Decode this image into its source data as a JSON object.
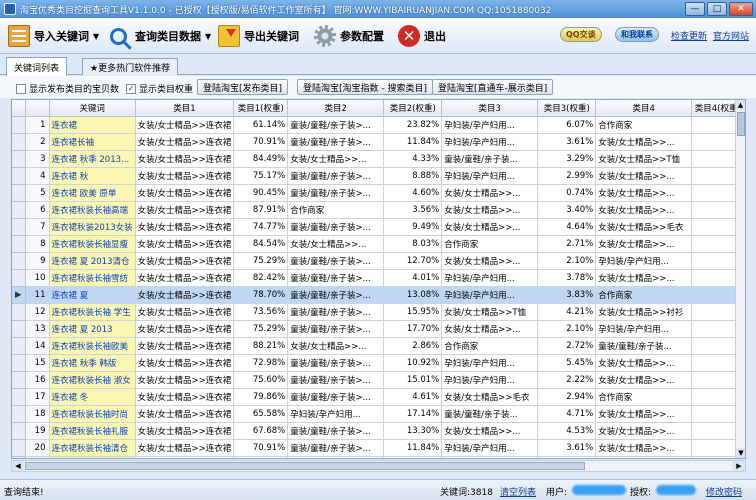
{
  "window": {
    "title": "淘宝优秀类目挖掘查询工具V1.1.0.0 - 已授权【授权版/易佰软件工作室所有】 官网:WWW.YIBAIRUANJIAN.COM QQ:1051880032",
    "min": "—",
    "max": "□",
    "close": "✕"
  },
  "toolbar": {
    "import_label": "导入关键词",
    "search_label": "查询类目数据",
    "export_label": "导出关键词",
    "settings_label": "参数配置",
    "exit_label": "退出",
    "qq_label": "QQ交谈",
    "contact_label": "和我联系",
    "check_update_label": "检查更新",
    "website_label": "官方网站"
  },
  "tabs": [
    {
      "label": "关键词列表"
    },
    {
      "label": "★更多热门软件推荐"
    }
  ],
  "options": {
    "show_shop_count_label": "显示发布类目的宝贝数",
    "show_weight_label": "显示类目权重",
    "show_shop_count_checked": false,
    "show_weight_checked": true,
    "btn1": "登陆淘宝[发布类目]",
    "btn2": "登陆淘宝[淘宝指数 - 搜索类目]",
    "btn3": "登陆淘宝[直通车-展示类目]"
  },
  "grid": {
    "columns": [
      "",
      "",
      "关键词",
      "类目1",
      "类目1(权重)",
      "类目2",
      "类目2(权重)",
      "类目3",
      "类目3(权重)",
      "类目4",
      "类目4(权重)"
    ],
    "selected_index": 10,
    "rows": [
      [
        "1",
        "连衣裙",
        "女装/女士精品>>连衣裙",
        "61.14%",
        "童装/童鞋/亲子装>...",
        "23.82%",
        "孕妇装/孕产妇用...",
        "6.07%",
        "合作商家",
        "4"
      ],
      [
        "2",
        "连衣裙长袖",
        "女装/女士精品>>连衣裙",
        "70.91%",
        "童装/童鞋/亲子装>...",
        "11.84%",
        "孕妇装/孕产妇用...",
        "3.61%",
        "女装/女士精品>>...",
        "3"
      ],
      [
        "3",
        "连衣裙 秋季 2013...",
        "女装/女士精品>>连衣裙",
        "84.49%",
        "女装/女士精品>>...",
        "4.33%",
        "童装/童鞋/亲子装...",
        "3.29%",
        "女装/女士精品>>T恤",
        "1"
      ],
      [
        "4",
        "连衣裙 秋",
        "女装/女士精品>>连衣裙",
        "75.17%",
        "童装/童鞋/亲子装>...",
        "8.88%",
        "孕妇装/孕产妇用...",
        "2.99%",
        "女装/女士精品>>...",
        "2"
      ],
      [
        "5",
        "连衣裙 欧美 原单",
        "女装/女士精品>>连衣裙",
        "90.45%",
        "童装/童鞋/亲子装>...",
        "4.60%",
        "女装/女士精品>>...",
        "0.74%",
        "女装/女士精品>>...",
        "0"
      ],
      [
        "6",
        "连衣裙秋装长袖高端",
        "女装/女士精品>>连衣裙",
        "87.91%",
        "合作商家",
        "3.56%",
        "女装/女士精品>>...",
        "3.40%",
        "女装/女士精品>>...",
        "2"
      ],
      [
        "7",
        "连衣裙秋装2013女装",
        "女装/女士精品>>连衣裙",
        "74.77%",
        "童装/童鞋/亲子装>...",
        "9.49%",
        "女装/女士精品>>...",
        "4.64%",
        "女装/女士精品>>毛衣",
        "3"
      ],
      [
        "8",
        "连衣裙秋装长袖显瘦",
        "女装/女士精品>>连衣裙",
        "84.54%",
        "女装/女士精品>>...",
        "8.03%",
        "合作商家",
        "2.71%",
        "女装/女士精品>>...",
        "0"
      ],
      [
        "9",
        "连衣裙 夏 2013清仓",
        "女装/女士精品>>连衣裙",
        "75.29%",
        "童装/童鞋/亲子装>...",
        "12.70%",
        "女装/女士精品>>...",
        "2.10%",
        "孕妇装/孕产妇用...",
        "2"
      ],
      [
        "10",
        "连衣裙秋装长袖雪纺",
        "女装/女士精品>>连衣裙",
        "82.42%",
        "童装/童鞋/亲子装>...",
        "4.01%",
        "孕妇装/孕产妇用...",
        "3.78%",
        "女装/女士精品>>...",
        "3"
      ],
      [
        "11",
        "连衣裙 夏",
        "女装/女士精品>>连衣裙",
        "78.70%",
        "童装/童鞋/亲子装>...",
        "13.08%",
        "孕妇装/孕产妇用...",
        "3.83%",
        "合作商家",
        "1"
      ],
      [
        "12",
        "连衣裙秋装长袖 学生",
        "女装/女士精品>>连衣裙",
        "73.56%",
        "童装/童鞋/亲子装>...",
        "15.95%",
        "女装/女士精品>>T恤",
        "4.21%",
        "女装/女士精品>>衬衫",
        "1"
      ],
      [
        "13",
        "连衣裙 夏 2013",
        "女装/女士精品>>连衣裙",
        "75.29%",
        "童装/童鞋/亲子装>...",
        "17.70%",
        "女装/女士精品>>...",
        "2.10%",
        "孕妇装/孕产妇用...",
        "2"
      ],
      [
        "14",
        "连衣裙秋装长袖欧美",
        "女装/女士精品>>连衣裙",
        "88.21%",
        "女装/女士精品>>...",
        "2.86%",
        "合作商家",
        "2.72%",
        "童装/童鞋/亲子装...",
        "1"
      ],
      [
        "15",
        "连衣裙 秋季 韩版",
        "女装/女士精品>>连衣裙",
        "72.98%",
        "童装/童鞋/亲子装>...",
        "10.92%",
        "孕妇装/孕产妇用...",
        "5.45%",
        "女装/女士精品>>...",
        "3"
      ],
      [
        "16",
        "连衣裙秋装长袖 淑女",
        "女装/女士精品>>连衣裙",
        "75.60%",
        "童装/童鞋/亲子装>...",
        "15.01%",
        "孕妇装/孕产妇用...",
        "2.22%",
        "女装/女士精品>>...",
        "1"
      ],
      [
        "17",
        "连衣裙 冬",
        "女装/女士精品>>连衣裙",
        "79.86%",
        "童装/童鞋/亲子装>...",
        "4.61%",
        "女装/女士精品>>毛衣",
        "2.94%",
        "合作商家",
        "2"
      ],
      [
        "18",
        "连衣裙秋装长袖时尚",
        "女装/女士精品>>连衣裙",
        "65.58%",
        "孕妇装/孕产妇用...",
        "17.14%",
        "童装/童鞋/亲子装...",
        "4.71%",
        "女装/女士精品>>...",
        "3"
      ],
      [
        "19",
        "连衣裙秋装长袖礼服",
        "女装/女士精品>>连衣裙",
        "67.68%",
        "童装/童鞋/亲子装>...",
        "13.30%",
        "女装/女士精品>>...",
        "4.53%",
        "女装/女士精品>>...",
        "3"
      ],
      [
        "20",
        "连衣裙秋装长袖清仓",
        "女装/女士精品>>连衣裙",
        "70.91%",
        "童装/童鞋/亲子装>...",
        "11.84%",
        "孕妇装/孕产妇用...",
        "3.61%",
        "女装/女士精品>>...",
        "3"
      ],
      [
        "21",
        "连衣裙秋装长袖秒杀",
        "女装/女士精品>>连衣裙",
        "70.91%",
        "童装/童鞋/亲子装>...",
        "11.84%",
        "孕妇装/孕产妇用...",
        "3.61%",
        "女装/女士精品>>...",
        "3"
      ]
    ]
  },
  "status": {
    "message": "查询结束!",
    "keyword_count": "关键词:3818",
    "clear_list": "清空列表",
    "user_label": "用户:",
    "license_label": "授权:",
    "change_password": "修改密码"
  }
}
